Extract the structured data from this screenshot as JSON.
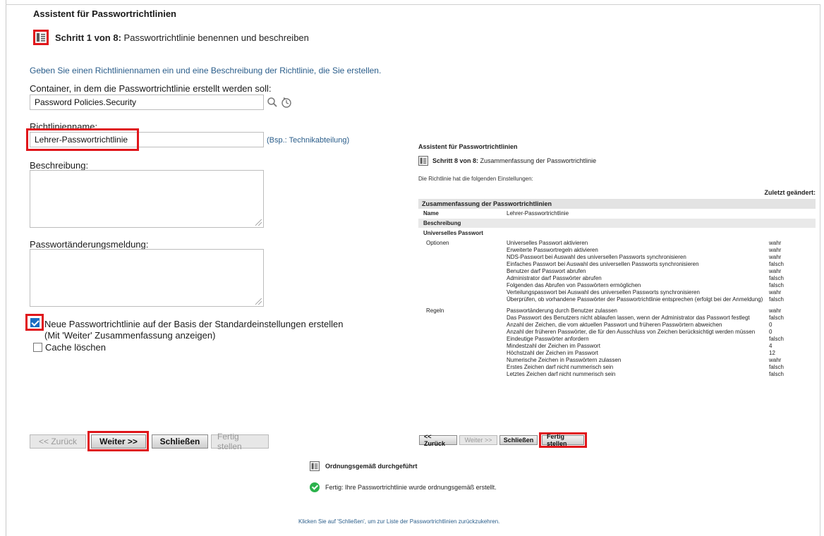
{
  "wizard_title": "Assistent für Passwortrichtlinien",
  "step1": {
    "step_label": "Schritt 1 von 8:",
    "step_text": "Passwortrichtlinie benennen und beschreiben"
  },
  "intro_hint": "Geben Sie einen Richtliniennamen ein und eine Beschreibung der Richtlinie, die Sie erstellen.",
  "container": {
    "label": "Container, in dem die Passwortrichtlinie erstellt werden soll:",
    "value": "Password Policies.Security"
  },
  "policy_name": {
    "label": "Richtlinienname:",
    "value": "Lehrer-Passwortrichtlinie",
    "example": "(Bsp.: Technikabteilung)"
  },
  "description": {
    "label": "Beschreibung:",
    "value": ""
  },
  "change_message": {
    "label": "Passwortänderungsmeldung:",
    "value": ""
  },
  "options": {
    "default_settings": "Neue Passwortrichtlinie auf der Basis der Standardeinstellungen erstellen",
    "default_settings_sub": "(Mit 'Weiter' Zusammenfassung anzeigen)",
    "clear_cache": "Cache löschen"
  },
  "buttons": {
    "back": "<< Zurück",
    "next": "Weiter >>",
    "close": "Schließen",
    "finish": "Fertig stellen"
  },
  "summary_panel": {
    "title": "Assistent für Passwortrichtlinien",
    "step_label": "Schritt 8 von 8:",
    "step_text": "Zusammenfassung der Passwortrichtlinie",
    "hint": "Die Richtlinie hat die folgenden Einstellungen:",
    "last_changed": "Zuletzt geändert:",
    "table_header": "Zusammenfassung der Passwortrichtlinien",
    "name_key": "Name",
    "name_value": "Lehrer-Passwortrichtlinie",
    "description_key": "Beschreibung",
    "universal_key": "Universelles Passwort",
    "options_key": "Optionen",
    "options": [
      {
        "text": "Universelles Passwort aktivieren",
        "value": "wahr"
      },
      {
        "text": "Erweiterte Passwortregeln aktivieren",
        "value": "wahr"
      },
      {
        "text": "NDS-Passwort bei Auswahl des universellen Passworts synchronisieren",
        "value": "wahr"
      },
      {
        "text": "Einfaches Passwort bei Auswahl des universellen Passworts synchronisieren",
        "value": "falsch"
      },
      {
        "text": "Benutzer darf Passwort abrufen",
        "value": "wahr"
      },
      {
        "text": "Administrator darf Passwörter abrufen",
        "value": "falsch"
      },
      {
        "text": "Folgenden das Abrufen von Passwörtern ermöglichen",
        "value": "falsch"
      },
      {
        "text": "Verteilungspasswort bei Auswahl des universellen Passworts synchronisieren",
        "value": "wahr"
      },
      {
        "text": "Überprüfen, ob vorhandene Passwörter der Passwortrichtlinie entsprechen (erfolgt bei der Anmeldung)",
        "value": "falsch"
      }
    ],
    "rules_key": "Regeln",
    "rules": [
      {
        "text": "Passwortänderung durch Benutzer zulassen",
        "value": "wahr"
      },
      {
        "text": "Das Passwort des Benutzers nicht ablaufen lassen, wenn der Administrator das Passwort festlegt",
        "value": "falsch"
      },
      {
        "text": "Anzahl der Zeichen, die vom aktuellen Passwort und früheren Passwörtern abweichen",
        "value": "0"
      },
      {
        "text": "Anzahl der früheren Passwörter, die für den Ausschluss von Zeichen berücksichtigt werden müssen",
        "value": "0"
      },
      {
        "text": "Eindeutige Passwörter anfordern",
        "value": "falsch"
      },
      {
        "text": "Mindestzahl der Zeichen im Passwort",
        "value": "4"
      },
      {
        "text": "Höchstzahl der Zeichen im Passwort",
        "value": "12"
      },
      {
        "text": "Numerische Zeichen in Passwörtern zulassen",
        "value": "wahr"
      },
      {
        "text": "Erstes Zeichen darf nicht nummerisch sein",
        "value": "falsch"
      },
      {
        "text": "Letztes Zeichen darf nicht nummerisch sein",
        "value": "falsch"
      }
    ],
    "buttons": {
      "back": "<< Zurück",
      "next": "Weiter >>",
      "close": "Schließen",
      "finish": "Fertig stellen"
    }
  },
  "result": {
    "title": "Ordnungsgemäß durchgeführt",
    "message": "Fertig: Ihre Passwortrichtlinie wurde ordnungsgemäß erstellt.",
    "close_hint": "Klicken Sie auf 'Schließen', um zur Liste der Passwortrichtlinien zurückzukehren."
  },
  "colors": {
    "highlight": "#e0161b",
    "link_text": "#2a5d8a",
    "checkbox": "#1b6ec2",
    "success": "#2bb24c"
  }
}
